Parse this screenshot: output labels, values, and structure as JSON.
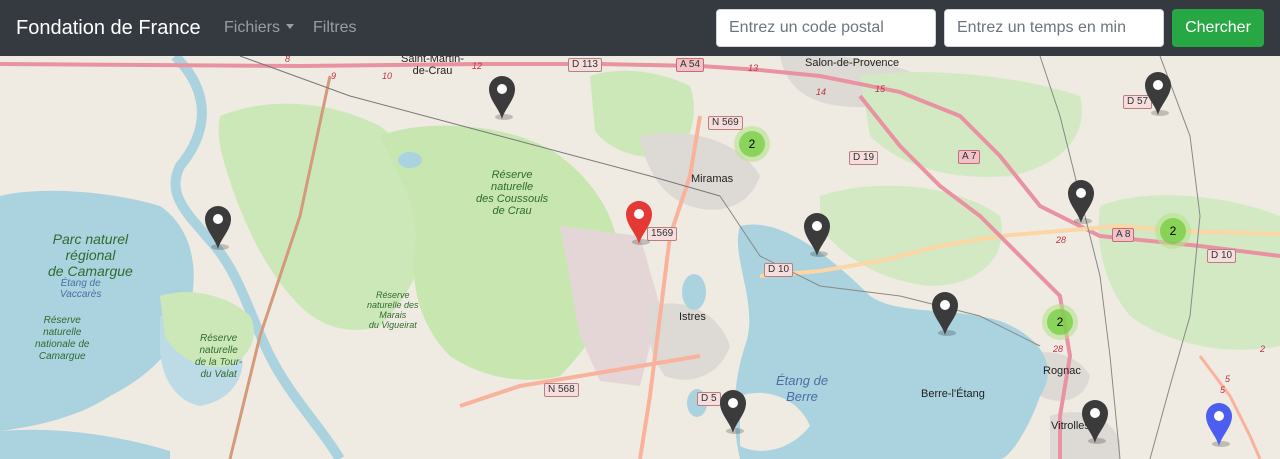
{
  "navbar": {
    "brand": "Fondation de France",
    "files_menu": "Fichiers",
    "filters_link": "Filtres",
    "postal_placeholder": "Entrez un code postal",
    "minutes_placeholder": "Entrez un temps en min",
    "search_button": "Chercher",
    "colors": {
      "background": "#343a40",
      "button": "#28a745"
    }
  },
  "map": {
    "labels": {
      "saint_martin": [
        "Saint-Martin-",
        "de-Crau"
      ],
      "salon": "Salon-de-Provence",
      "miramas": "Miramas",
      "istres": "Istres",
      "berre": "Berre-l'Étang",
      "rognac": "Rognac",
      "vitrolles": "Vitrolles",
      "camargue_park": [
        "Parc naturel",
        "régional",
        "de Camargue"
      ],
      "vaccares": [
        "Étang de",
        "Vaccarès"
      ],
      "reserve_camargue": [
        "Réserve",
        "naturelle",
        "nationale de",
        "Camargue"
      ],
      "reserve_tour_valat": [
        "Réserve",
        "naturelle",
        "de la Tour-",
        "du Valat"
      ],
      "reserve_coussouls": [
        "Réserve",
        "naturelle",
        "des Coussouls",
        "de Crau"
      ],
      "reserve_vigueirat": [
        "Réserve",
        "naturelle des",
        "Marais",
        "du Vigueirat"
      ],
      "etang_berre": [
        "Étang de",
        "Berre"
      ]
    },
    "roads": {
      "d113": "D 113",
      "a54": "A 54",
      "n569": "N 569",
      "d19": "D 19",
      "a7": "A 7",
      "d10_left": "D 10",
      "d569": "1569",
      "a8": "A 8",
      "d10_right": "D 10",
      "d57": "D 57",
      "n568": "N 568",
      "d5": "D 5"
    },
    "junctions": {
      "j8": "8",
      "j9": "9",
      "j10": "10",
      "j12": "12",
      "j13": "13",
      "j14": "14",
      "j15": "15",
      "j28a": "28",
      "j28b": "28",
      "j2": "2",
      "j5a": "5",
      "j5b": "5"
    },
    "clusters": [
      {
        "count": "2"
      },
      {
        "count": "2"
      },
      {
        "count": "2"
      }
    ],
    "markers": [
      {
        "icon": "map-pin-icon",
        "color": "#3b3b3b",
        "kind": "grey"
      },
      {
        "icon": "map-pin-icon",
        "color": "#3b3b3b",
        "kind": "grey"
      },
      {
        "icon": "map-pin-icon",
        "color": "#3b3b3b",
        "kind": "grey"
      },
      {
        "icon": "map-pin-icon",
        "color": "#3b3b3b",
        "kind": "grey"
      },
      {
        "icon": "map-pin-icon",
        "color": "#3b3b3b",
        "kind": "grey"
      },
      {
        "icon": "map-pin-icon",
        "color": "#3b3b3b",
        "kind": "grey"
      },
      {
        "icon": "map-pin-icon",
        "color": "#3b3b3b",
        "kind": "grey"
      },
      {
        "icon": "map-pin-icon",
        "color": "#3b3b3b",
        "kind": "grey"
      },
      {
        "icon": "map-pin-icon",
        "color": "#e53935",
        "kind": "red"
      },
      {
        "icon": "map-pin-icon",
        "color": "#4c5ef0",
        "kind": "blue"
      }
    ]
  }
}
